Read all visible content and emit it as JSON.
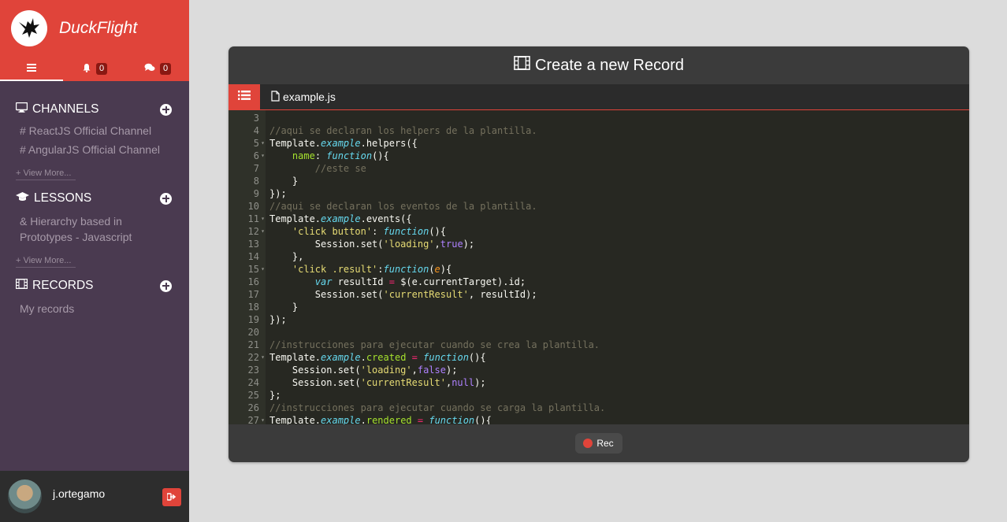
{
  "app": {
    "name": "DuckFlight"
  },
  "tabs": {
    "notifications_count": "0",
    "messages_count": "0"
  },
  "sections": {
    "channels": {
      "title": "CHANNELS",
      "items": [
        "# ReactJS Official Channel",
        "# AngularJS Official Channel"
      ],
      "view_more": "+ View More..."
    },
    "lessons": {
      "title": "LESSONS",
      "items": [
        "& Hierarchy based in Prototypes - Javascript"
      ],
      "view_more": "+ View More..."
    },
    "records": {
      "title": "RECORDS",
      "items": [
        "My records"
      ]
    }
  },
  "user": {
    "name": "j.ortegamo"
  },
  "panel": {
    "title": "Create a new Record",
    "file_name": "example.js",
    "rec_label": "Rec"
  },
  "editor": {
    "line_numbers": [
      "3",
      "4",
      "5",
      "6",
      "7",
      "8",
      "9",
      "10",
      "11",
      "12",
      "13",
      "14",
      "15",
      "16",
      "17",
      "18",
      "19",
      "20",
      "21",
      "22",
      "23",
      "24",
      "25",
      "26",
      "27"
    ],
    "fold_lines": [
      "5",
      "6",
      "11",
      "12",
      "15",
      "22",
      "27"
    ],
    "lines": [
      "",
      "//aqui se declaran los helpers de la plantilla.",
      "Template.example.helpers({",
      "    name: function(){",
      "        //este se",
      "    }",
      "});",
      "//aqui se declaran los eventos de la plantilla.",
      "Template.example.events({",
      "    'click button': function(){",
      "        Session.set('loading',true);",
      "    },",
      "    'click .result':function(e){",
      "        var resultId = $(e.currentTarget).id;",
      "        Session.set('currentResult', resultId);",
      "    }",
      "});",
      "",
      "//instrucciones para ejecutar cuando se crea la plantilla.",
      "Template.example.created = function(){",
      "    Session.set('loading',false);",
      "    Session.set('currentResult',null);",
      "};",
      "//instrucciones para ejecutar cuando se carga la plantilla.",
      "Template.example.rendered = function(){"
    ]
  },
  "colors": {
    "accent": "#e0443a",
    "sidebar": "#4a3a50",
    "editor_bg": "#272822"
  }
}
